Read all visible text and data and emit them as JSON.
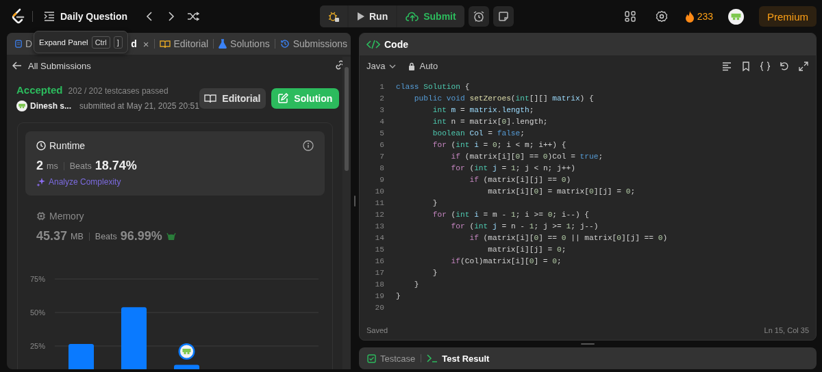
{
  "nav": {
    "title": "Daily Question",
    "run": "Run",
    "submit": "Submit",
    "streak": "233",
    "premium": "Premium"
  },
  "left_panel": {
    "tabs": [
      {
        "label": "D",
        "kind": "description",
        "selected": false
      },
      {
        "label": "d",
        "kind": "result",
        "selected": true,
        "close": "×"
      },
      {
        "label": "Editorial",
        "kind": "editorial",
        "selected": false
      },
      {
        "label": "Solutions",
        "kind": "solutions",
        "selected": false
      },
      {
        "label": "Submissions",
        "kind": "submissions",
        "selected": false
      }
    ],
    "tooltip": {
      "label": "Expand Panel",
      "keys": [
        "Ctrl",
        "]"
      ]
    },
    "back_link": "All Submissions",
    "status": "Accepted",
    "testcases": "202 / 202 testcases passed",
    "user": "Dinesh s...",
    "submitted": "submitted at May 21, 2025 20:51",
    "buttons": [
      {
        "label": "Editorial",
        "kind": "secondary"
      },
      {
        "label": "Solution",
        "kind": "primary"
      }
    ],
    "stats": [
      {
        "title": "Runtime",
        "kind": "runtime",
        "selected": true,
        "value": "2",
        "unit": "ms",
        "beats_label": "Beats",
        "beats": "18.74%",
        "analyze": "Analyze Complexity"
      },
      {
        "title": "Memory",
        "kind": "memory",
        "selected": false,
        "value": "45.37",
        "unit": "MB",
        "beats_label": "Beats",
        "beats": "96.99%"
      }
    ],
    "chart_data": {
      "type": "bar",
      "values": [
        26.5,
        54,
        11,
        null,
        null
      ],
      "ylim": [
        0,
        75
      ],
      "yticks": [
        {
          "value": 25,
          "label": "25%"
        },
        {
          "value": 50,
          "label": "50%"
        },
        {
          "value": 75,
          "label": "75%"
        }
      ]
    }
  },
  "editor": {
    "tab": "Code",
    "language": "Java",
    "mode": "Auto",
    "lines": [
      {
        "number": "1",
        "tokens": [
          {
            "text": "class",
            "kind": "kw"
          },
          {
            "text": " Solution",
            "kind": "ty"
          },
          {
            "text": " {",
            "kind": "p"
          }
        ]
      },
      {
        "number": "2",
        "tokens": [
          {
            "text": "    public",
            "kind": "kw"
          },
          {
            "text": " void",
            "kind": "kw"
          },
          {
            "text": " setZeroes",
            "kind": "fn"
          },
          {
            "text": "(",
            "kind": "p"
          },
          {
            "text": "int",
            "kind": "ty"
          },
          {
            "text": "[][]",
            "kind": "p"
          },
          {
            "text": " matrix",
            "kind": "v"
          },
          {
            "text": ") {",
            "kind": "p"
          }
        ]
      },
      {
        "number": "3",
        "tokens": [
          {
            "text": "        int",
            "kind": "ty"
          },
          {
            "text": " m",
            "kind": "v"
          },
          {
            "text": " =",
            "kind": "p"
          },
          {
            "text": " matrix",
            "kind": "v"
          },
          {
            "text": ".",
            "kind": "p"
          },
          {
            "text": "length",
            "kind": "v"
          },
          {
            "text": ";",
            "kind": "p"
          }
        ]
      },
      {
        "number": "4",
        "tokens": [
          {
            "text": "        int",
            "kind": "ty"
          },
          {
            "text": " n = matrix[",
            "kind": "p"
          },
          {
            "text": "0",
            "kind": "n"
          },
          {
            "text": "].length;",
            "kind": "p"
          }
        ]
      },
      {
        "number": "5",
        "tokens": [
          {
            "text": "        boolean",
            "kind": "ty"
          },
          {
            "text": " Col",
            "kind": "v"
          },
          {
            "text": " =",
            "kind": "p"
          },
          {
            "text": " false",
            "kind": "kw"
          },
          {
            "text": ";",
            "kind": "p"
          }
        ]
      },
      {
        "number": "6",
        "tokens": [
          {
            "text": "        for",
            "kind": "ctl"
          },
          {
            "text": " (",
            "kind": "p"
          },
          {
            "text": "int",
            "kind": "ty"
          },
          {
            "text": " i",
            "kind": "v"
          },
          {
            "text": " =",
            "kind": "p"
          },
          {
            "text": " 0",
            "kind": "n"
          },
          {
            "text": "; i < m; i++) {",
            "kind": "p"
          }
        ]
      },
      {
        "number": "7",
        "tokens": [
          {
            "text": "            if",
            "kind": "ctl"
          },
          {
            "text": " (matrix[i][",
            "kind": "p"
          },
          {
            "text": "0",
            "kind": "n"
          },
          {
            "text": "] ==",
            "kind": "p"
          },
          {
            "text": " 0",
            "kind": "n"
          },
          {
            "text": ")Col =",
            "kind": "p"
          },
          {
            "text": " true",
            "kind": "kw"
          },
          {
            "text": ";",
            "kind": "p"
          }
        ]
      },
      {
        "number": "8",
        "tokens": [
          {
            "text": "            for",
            "kind": "ctl"
          },
          {
            "text": " (",
            "kind": "p"
          },
          {
            "text": "int",
            "kind": "ty"
          },
          {
            "text": " j",
            "kind": "v"
          },
          {
            "text": " =",
            "kind": "p"
          },
          {
            "text": " 1",
            "kind": "n"
          },
          {
            "text": "; j < n; j++)",
            "kind": "p"
          }
        ]
      },
      {
        "number": "9",
        "tokens": [
          {
            "text": "                if",
            "kind": "ctl"
          },
          {
            "text": " (matrix[i][j] ==",
            "kind": "p"
          },
          {
            "text": " 0",
            "kind": "n"
          },
          {
            "text": ")",
            "kind": "p"
          }
        ]
      },
      {
        "number": "10",
        "tokens": [
          {
            "text": "                    matrix[i][",
            "kind": "p"
          },
          {
            "text": "0",
            "kind": "n"
          },
          {
            "text": "] = matrix[",
            "kind": "p"
          },
          {
            "text": "0",
            "kind": "n"
          },
          {
            "text": "][j] =",
            "kind": "p"
          },
          {
            "text": " 0",
            "kind": "n"
          },
          {
            "text": ";",
            "kind": "p"
          }
        ]
      },
      {
        "number": "11",
        "tokens": [
          {
            "text": "        }",
            "kind": "p"
          }
        ]
      },
      {
        "number": "12",
        "tokens": [
          {
            "text": "        for",
            "kind": "ctl"
          },
          {
            "text": " (",
            "kind": "p"
          },
          {
            "text": "int",
            "kind": "ty"
          },
          {
            "text": " i",
            "kind": "v"
          },
          {
            "text": " = m -",
            "kind": "p"
          },
          {
            "text": " 1",
            "kind": "n"
          },
          {
            "text": "; i >=",
            "kind": "p"
          },
          {
            "text": " 0",
            "kind": "n"
          },
          {
            "text": "; i--) {",
            "kind": "p"
          }
        ]
      },
      {
        "number": "13",
        "tokens": [
          {
            "text": "            for",
            "kind": "ctl"
          },
          {
            "text": " (",
            "kind": "p"
          },
          {
            "text": "int",
            "kind": "ty"
          },
          {
            "text": " j",
            "kind": "v"
          },
          {
            "text": " = n -",
            "kind": "p"
          },
          {
            "text": " 1",
            "kind": "n"
          },
          {
            "text": "; j >=",
            "kind": "p"
          },
          {
            "text": " 1",
            "kind": "n"
          },
          {
            "text": "; j--)",
            "kind": "p"
          }
        ]
      },
      {
        "number": "14",
        "tokens": [
          {
            "text": "                if",
            "kind": "ctl"
          },
          {
            "text": " (matrix[i][",
            "kind": "p"
          },
          {
            "text": "0",
            "kind": "n"
          },
          {
            "text": "] ==",
            "kind": "p"
          },
          {
            "text": " 0",
            "kind": "n"
          },
          {
            "text": " || matrix[",
            "kind": "p"
          },
          {
            "text": "0",
            "kind": "n"
          },
          {
            "text": "][j] ==",
            "kind": "p"
          },
          {
            "text": " 0",
            "kind": "n"
          },
          {
            "text": ")",
            "kind": "p"
          }
        ]
      },
      {
        "number": "15",
        "tokens": [
          {
            "text": "                    matrix[i][j] =",
            "kind": "p"
          },
          {
            "text": " 0",
            "kind": "n"
          },
          {
            "text": ";",
            "kind": "p"
          }
        ]
      },
      {
        "number": "16",
        "tokens": [
          {
            "text": "            if",
            "kind": "ctl"
          },
          {
            "text": "(Col)matrix[i][",
            "kind": "p"
          },
          {
            "text": "0",
            "kind": "n"
          },
          {
            "text": "] =",
            "kind": "p"
          },
          {
            "text": " 0",
            "kind": "n"
          },
          {
            "text": ";",
            "kind": "p"
          }
        ]
      },
      {
        "number": "17",
        "tokens": [
          {
            "text": "        }",
            "kind": "p"
          }
        ]
      },
      {
        "number": "18",
        "tokens": [
          {
            "text": "    }",
            "kind": "p"
          }
        ]
      },
      {
        "number": "19",
        "tokens": [
          {
            "text": "}",
            "kind": "p"
          }
        ]
      },
      {
        "number": "20"
      }
    ],
    "save_status": "Saved",
    "position": "Ln 15, Col 35"
  },
  "bottom_panel": {
    "tabs": [
      {
        "label": "Testcase",
        "kind": "testcase",
        "selected": false
      },
      {
        "label": "Test Result",
        "kind": "result",
        "selected": true
      }
    ]
  }
}
